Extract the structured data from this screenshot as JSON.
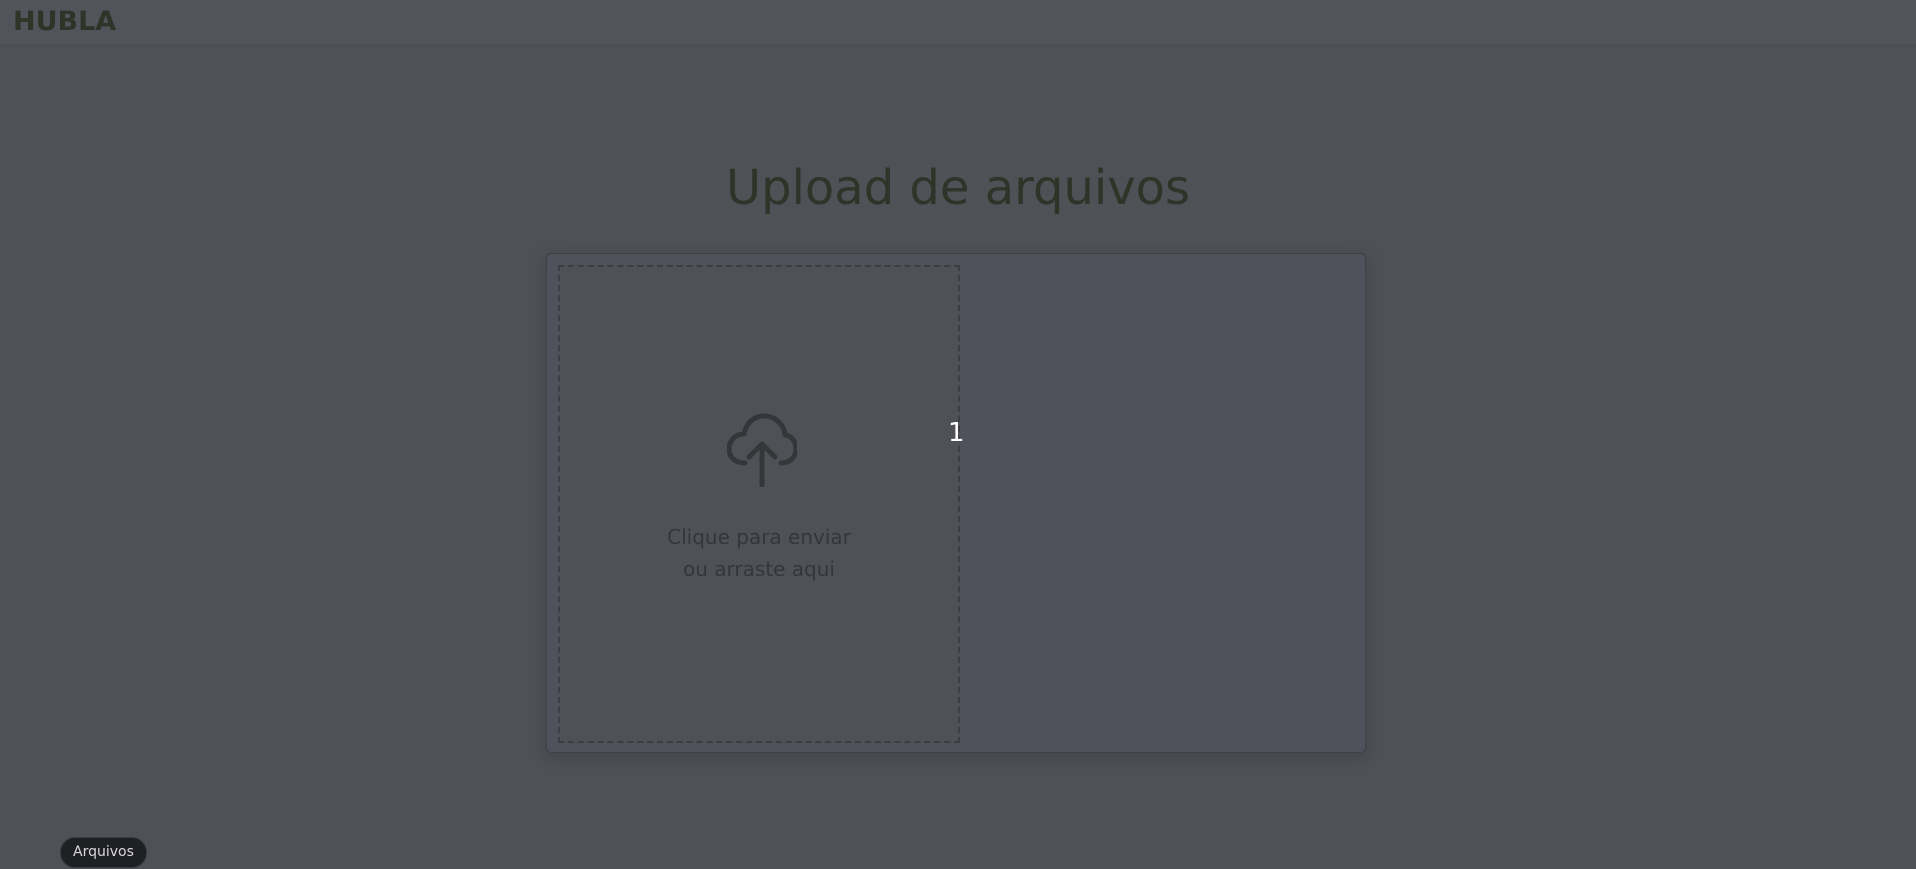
{
  "header": {
    "logo_text": "HUBLA"
  },
  "main": {
    "title": "Upload de arquivos",
    "dropzone": {
      "icon": "cloud-upload-icon",
      "line1": "Clique para enviar",
      "line2": "ou arraste aqui"
    },
    "marker_text": "1"
  },
  "footer": {
    "pill_label": "Arquivos"
  },
  "colors": {
    "background": "#4f5157",
    "text_dark": "#2f3328",
    "pill_bg": "#1f2023"
  }
}
